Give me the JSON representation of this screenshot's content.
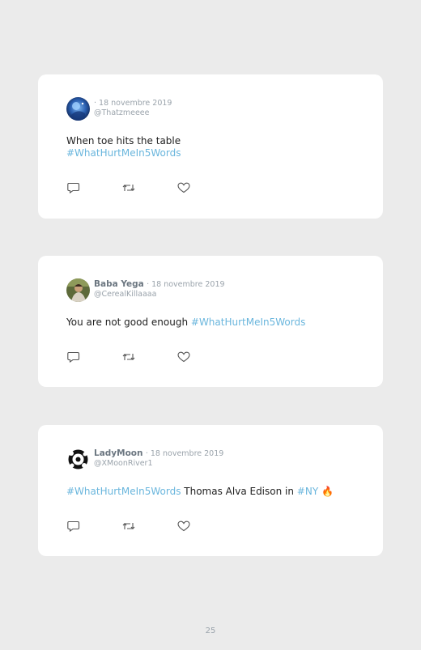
{
  "tweets": [
    {
      "name": "",
      "date": "· 18 novembre 2019",
      "handle": "@Thatzmeeee",
      "text_parts": [
        {
          "text": "When toe hits the table",
          "type": "plain"
        },
        {
          "text": "#WhatHurtMeIn5Words",
          "type": "hashtag"
        }
      ],
      "avatar": "galaxy-avatar"
    },
    {
      "name": "Baba Yega",
      "date": "· 18 novembre 2019",
      "handle": "@CerealKillaaaa",
      "text_parts": [
        {
          "text": "You are not good enough ",
          "type": "plain"
        },
        {
          "text": "#WhatHurtMeIn5Words",
          "type": "hashtag"
        }
      ],
      "avatar": "person-avatar"
    },
    {
      "name": "LadyMoon",
      "date": "· 18 novembre 2019",
      "handle": "@XMoonRiver1",
      "text_parts": [
        {
          "text": "#WhatHurtMeIn5Words",
          "type": "hashtag"
        },
        {
          "text": " Thomas Alva Edison in ",
          "type": "plain"
        },
        {
          "text": "#NY",
          "type": "hashtag"
        },
        {
          "text": "🔥",
          "type": "emoji"
        }
      ],
      "avatar": "moon-avatar"
    }
  ],
  "actions": [
    "reply-icon",
    "retweet-icon",
    "like-icon"
  ],
  "colors": {
    "hashtag": "#6ab6dd",
    "name": "#6b7680",
    "muted": "#9aa3ab",
    "background": "#ebebeb"
  },
  "page_number": "25"
}
